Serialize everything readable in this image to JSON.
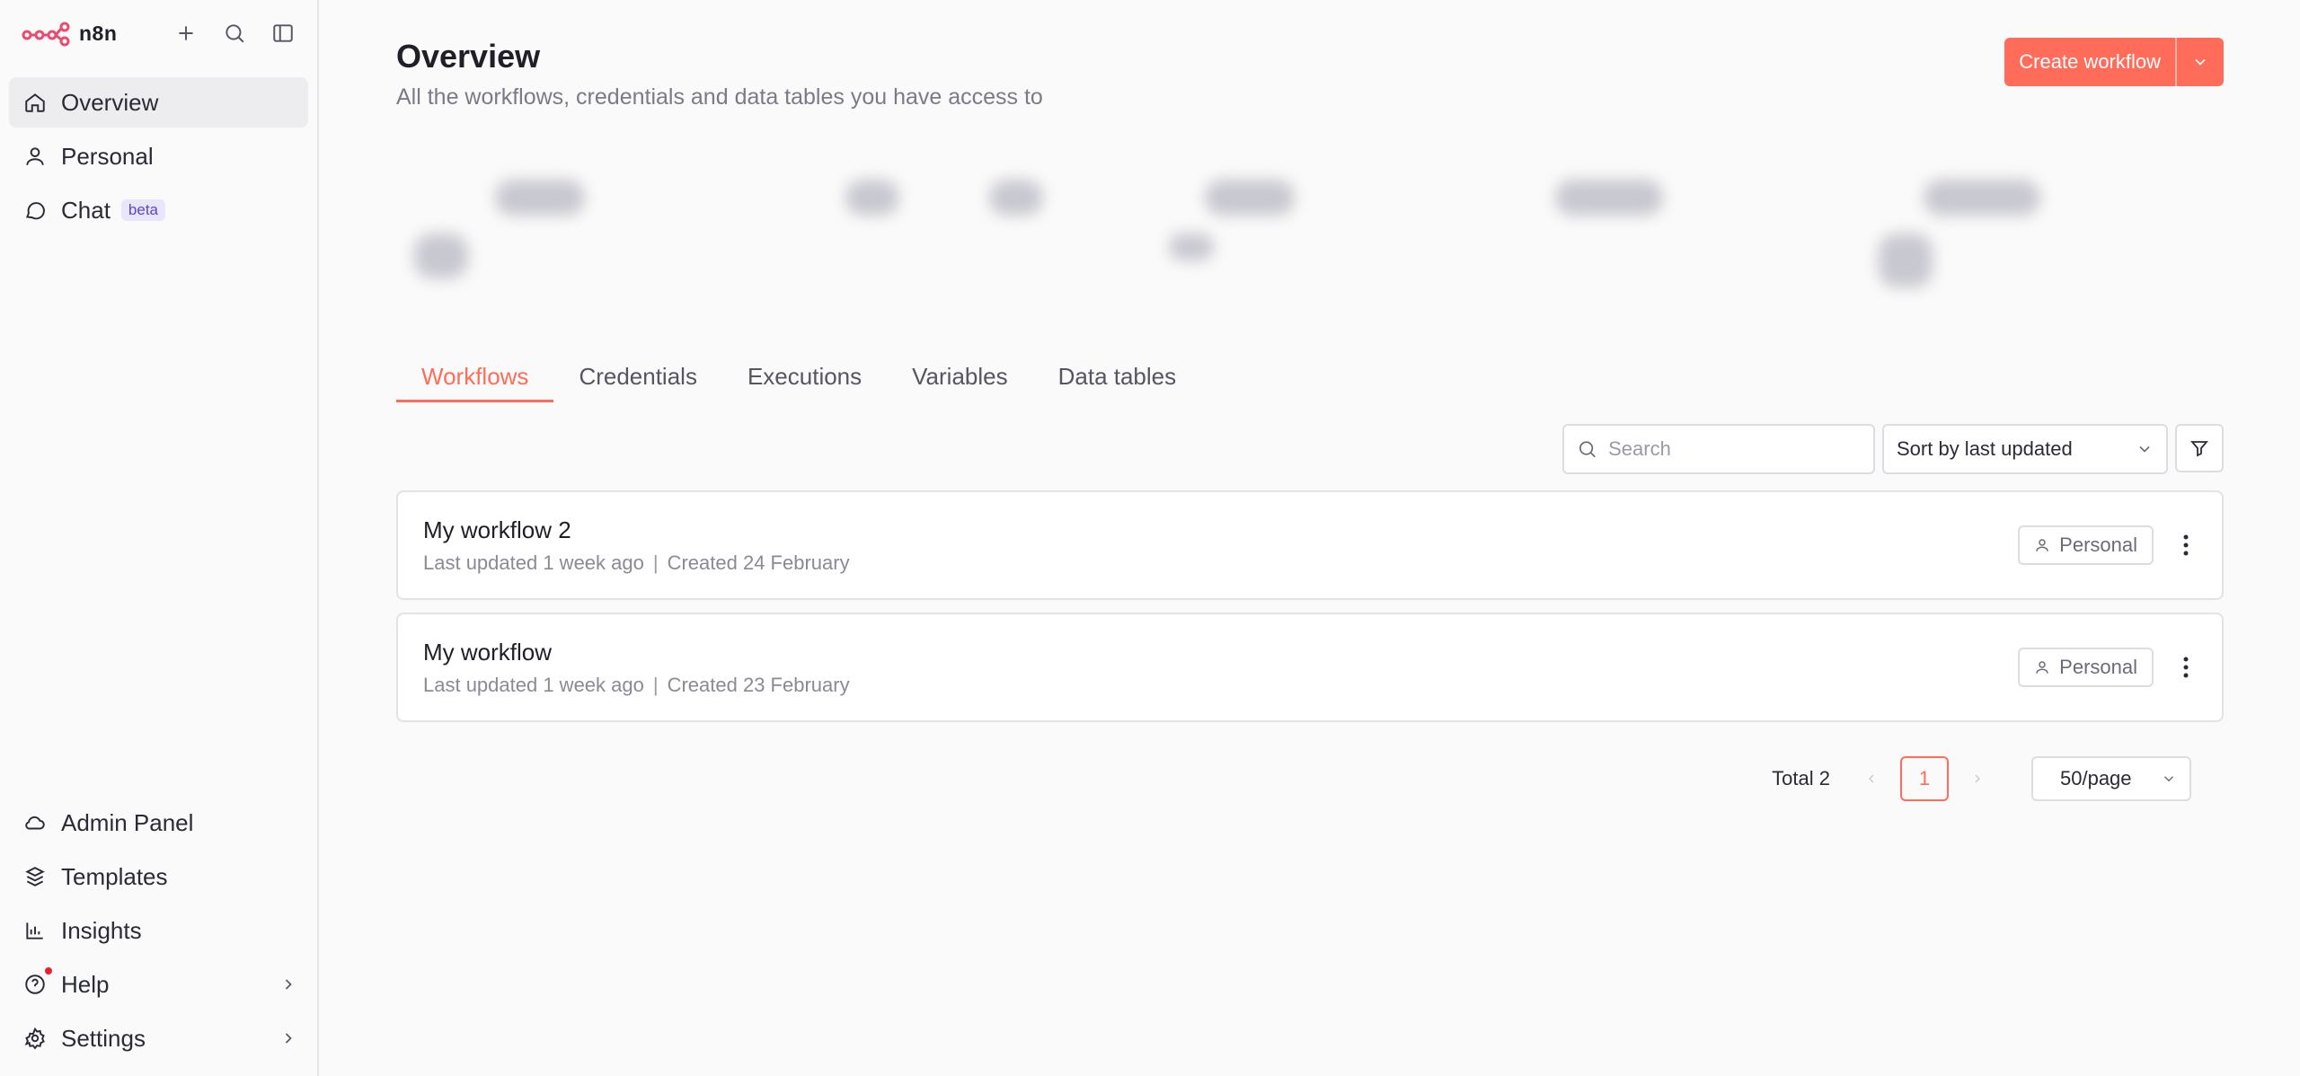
{
  "app": {
    "name": "n8n"
  },
  "sidebar": {
    "items": [
      {
        "label": "Overview",
        "icon": "home-icon",
        "active": true
      },
      {
        "label": "Personal",
        "icon": "user-icon"
      },
      {
        "label": "Chat",
        "icon": "chat-icon",
        "badge": "beta"
      }
    ],
    "bottom_items": [
      {
        "label": "Admin Panel",
        "icon": "cloud-icon"
      },
      {
        "label": "Templates",
        "icon": "box-icon"
      },
      {
        "label": "Insights",
        "icon": "bar-chart-icon"
      },
      {
        "label": "Help",
        "icon": "help-icon"
      },
      {
        "label": "Settings",
        "icon": "gear-icon"
      }
    ]
  },
  "header": {
    "title": "Overview",
    "subtitle": "All the workflows, credentials and data tables you have access to",
    "create_label": "Create workflow"
  },
  "tabs": [
    {
      "label": "Workflows",
      "active": true
    },
    {
      "label": "Credentials"
    },
    {
      "label": "Executions"
    },
    {
      "label": "Variables"
    },
    {
      "label": "Data tables"
    }
  ],
  "toolbar": {
    "search_placeholder": "Search",
    "sort_label": "Sort by last updated"
  },
  "workflows": [
    {
      "title": "My workflow 2",
      "updated": "Last updated 1 week ago",
      "separator": "|",
      "created": "Created 24 February",
      "owner": "Personal"
    },
    {
      "title": "My workflow",
      "updated": "Last updated 1 week ago",
      "separator": "|",
      "created": "Created 23 February",
      "owner": "Personal"
    }
  ],
  "pagination": {
    "total": "Total 2",
    "current_page": "1",
    "page_size": "50/page"
  },
  "colors": {
    "accent": "#ff6d5a",
    "sidebar_bg": "#fafafa",
    "active_bg": "#ededf0"
  }
}
